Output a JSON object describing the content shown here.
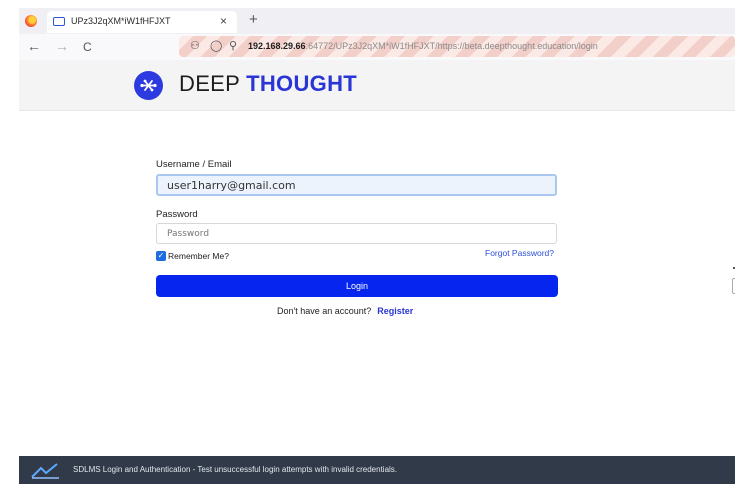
{
  "browser": {
    "tab_title": "UPz3J2qXM*iW1fHFJXT",
    "tab_close": "×",
    "new_tab": "+",
    "nav": {
      "back": "←",
      "forward": "→",
      "reload": "C"
    },
    "url_host": "192.168.29.66",
    "url_rest": ":64772/UPz3J2qXM*iW1fHFJXT/https://beta.deepthought.education/login"
  },
  "site": {
    "brand_light": "DEEP ",
    "brand_bold": "THOUGHT",
    "logo_color": "#2c3ae0"
  },
  "form": {
    "username_label": "Username / Email",
    "username_value": "user1harry@gmail.com",
    "password_label": "Password",
    "password_placeholder": "Password",
    "remember_label": "Remember Me?",
    "remember_checked": true,
    "forgot_link": "Forgot Password?",
    "login_button": "Login",
    "signup_prompt": "Don't have an account?",
    "register_link": "Register",
    "accent_color": "#0626f0"
  },
  "footer": {
    "caption": "SDLMS Login and Authentication - Test unsuccessful login attempts with invalid credentials."
  }
}
